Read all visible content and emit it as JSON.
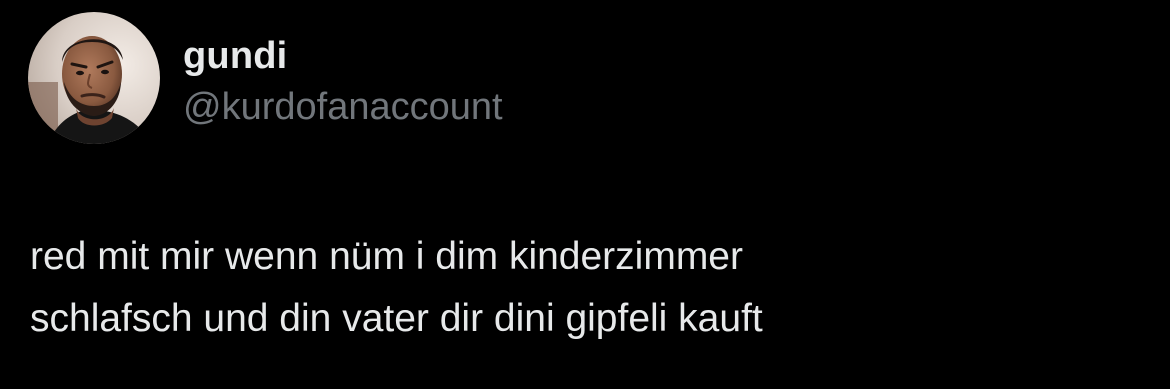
{
  "author": {
    "display_name": "gundi",
    "handle": "@kurdofanaccount",
    "avatar_icon": "profile-photo"
  },
  "tweet": {
    "lines": [
      "red mit mir wenn nüm i dim kinderzimmer",
      "schlafsch und din vater dir dini gipfeli kauft"
    ]
  },
  "colors": {
    "background": "#000000",
    "primary_text": "#e7e9ea",
    "secondary_text": "#71767b"
  }
}
